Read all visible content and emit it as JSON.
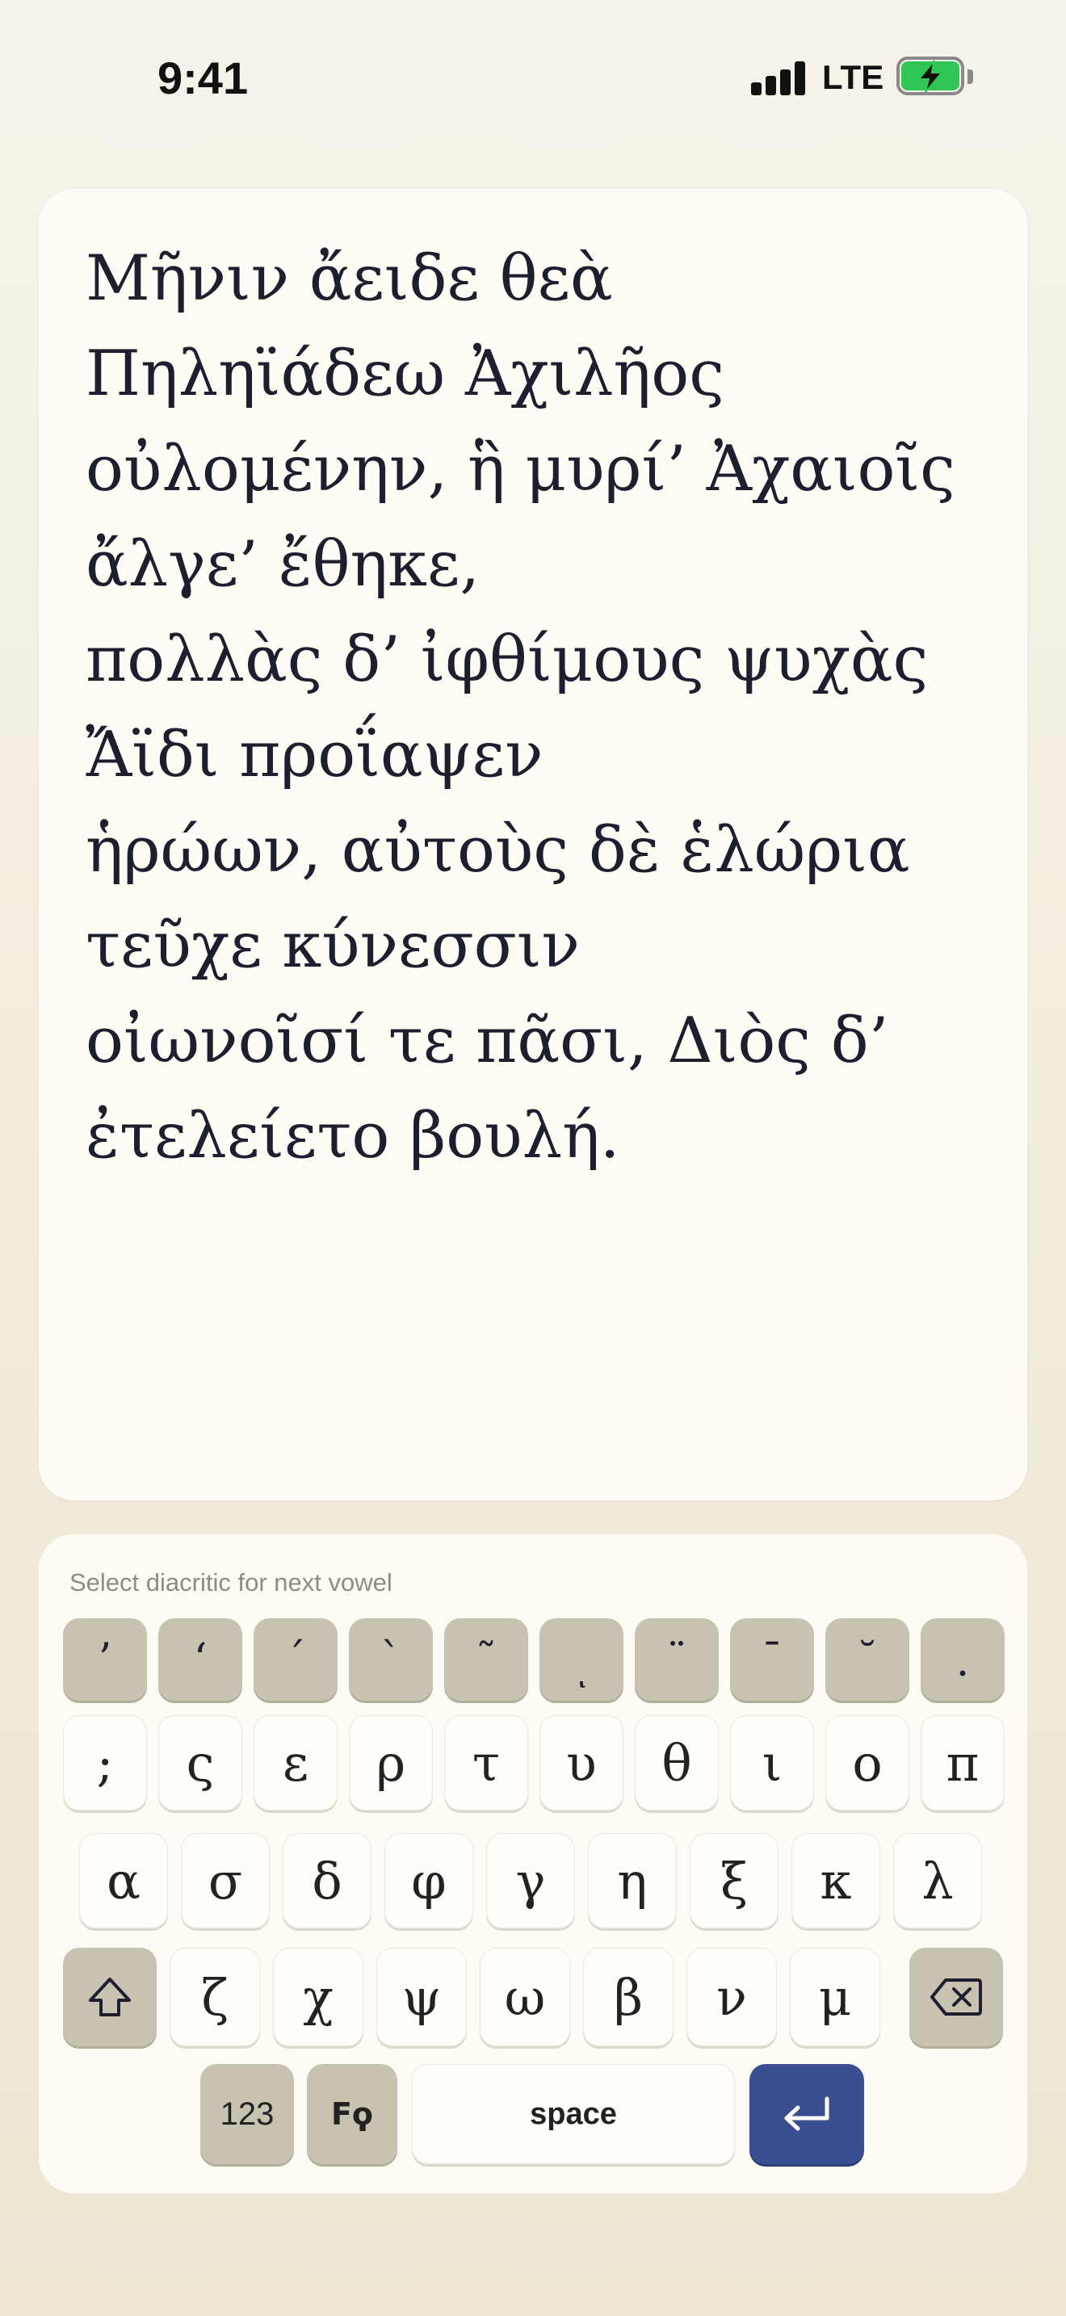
{
  "status_bar": {
    "time": "9:41",
    "network": "LTE",
    "battery": "charging"
  },
  "text_panel": {
    "lines": [
      "Μῆνιν ἄειδε θεὰ",
      "Πηληϊάδεω Ἀχιλῆος",
      "οὐλομένην, ἣ μυρί’ Ἀχαιοῖς",
      "ἄλγε’ ἔθηκε,",
      "πολλὰς δ’ ἰφθίμους ψυχὰς",
      "Ἄϊδι προΐαψεν",
      "ἡρώων, αὐτοὺς δὲ ἑλώρια",
      "τεῦχε κύνεσσιν",
      "οἰωνοῖσί τε πᾶσι, Διὸς δ’",
      "ἐτελείετο βουλή."
    ]
  },
  "keyboard": {
    "hint": "Select diacritic for next vowel",
    "diacritics": [
      "’",
      "‘",
      "´",
      "`",
      "˜",
      "ͺ",
      "¨",
      "¯",
      "˘",
      "."
    ],
    "row1": [
      ";",
      "ς",
      "ε",
      "ρ",
      "τ",
      "υ",
      "θ",
      "ι",
      "ο",
      "π"
    ],
    "row2": [
      "α",
      "σ",
      "δ",
      "φ",
      "γ",
      "η",
      "ξ",
      "κ",
      "λ"
    ],
    "row3": [
      "ζ",
      "χ",
      "ψ",
      "ω",
      "β",
      "ν",
      "μ"
    ],
    "numbers_label": "123",
    "language_label": "Fϙ",
    "space_label": "space",
    "colors": {
      "accent": "#3a4f92",
      "modifier": "#c8c3b0",
      "panel": "#fefcf5"
    },
    "icons": {
      "shift": "shift-icon",
      "delete": "backspace-icon",
      "return": "return-icon"
    }
  }
}
